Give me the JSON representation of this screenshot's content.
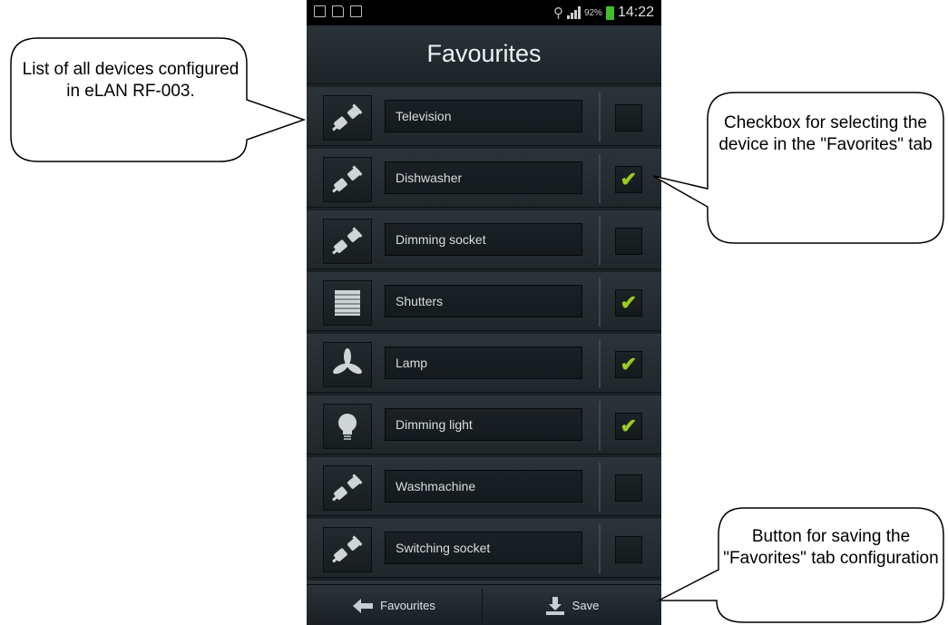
{
  "status_bar": {
    "left_icons": [
      "image-icon",
      "document-icon",
      "clipboard-check-icon"
    ],
    "battery_percent": "92%",
    "time": "14:22"
  },
  "header": {
    "title": "Favourites"
  },
  "devices": [
    {
      "name": "Television",
      "icon": "socket-plug-icon",
      "checked": false
    },
    {
      "name": "Dishwasher",
      "icon": "socket-plug-icon",
      "checked": true
    },
    {
      "name": "Dimming socket",
      "icon": "socket-plug-icon",
      "checked": false
    },
    {
      "name": "Shutters",
      "icon": "shutters-icon",
      "checked": true
    },
    {
      "name": "Lamp",
      "icon": "fan-icon",
      "checked": true
    },
    {
      "name": "Dimming light",
      "icon": "lightbulb-icon",
      "checked": true
    },
    {
      "name": "Washmachine",
      "icon": "socket-plug-icon",
      "checked": false
    },
    {
      "name": "Switching socket",
      "icon": "socket-plug-icon",
      "checked": false
    },
    {
      "name": "",
      "icon": "fan-icon",
      "checked": false
    }
  ],
  "bottom_bar": {
    "back_label": "Favourites",
    "save_label": "Save"
  },
  "callouts": {
    "list": "List of all devices configured in eLAN RF-003.",
    "checkbox": "Checkbox for selecting the device in the \"Favorites\" tab",
    "save": "Button for saving the \"Favorites\" tab configuration"
  },
  "colors": {
    "check": "#9acd1f",
    "battery": "#3fbf2a",
    "background": "#1b2226"
  }
}
